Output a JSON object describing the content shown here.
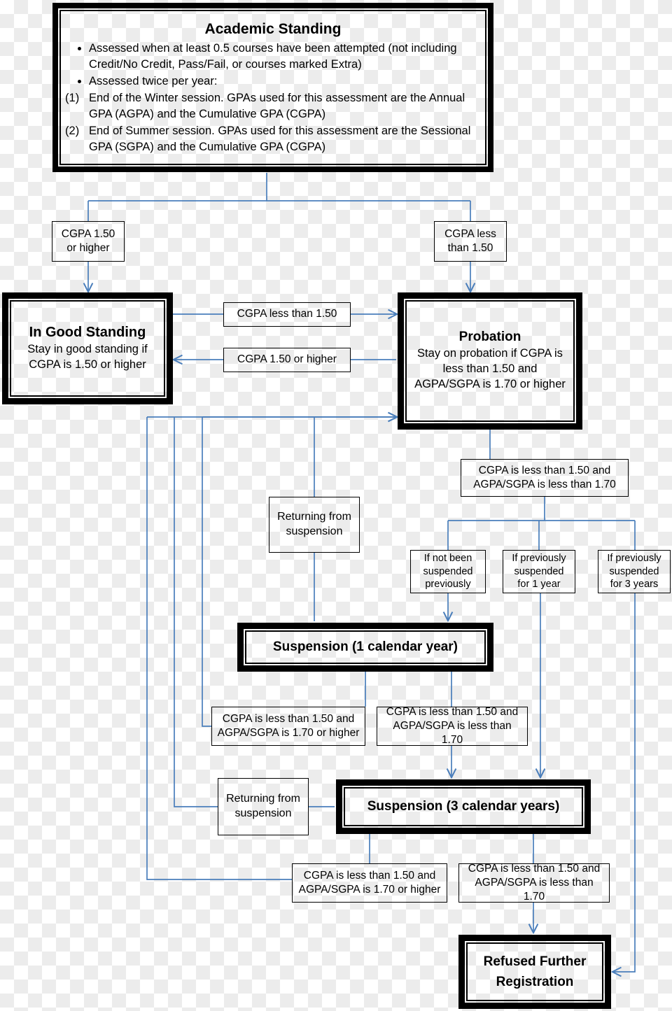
{
  "diagram": {
    "title": "Academic Standing",
    "accent_line_color": "#4a7ebb",
    "node_border_color": "#000000"
  },
  "header": {
    "title": "Academic Standing",
    "bullets": [
      "Assessed when at least 0.5 courses have been attempted (not including Credit/No Credit, Pass/Fail, or courses marked Extra)",
      "Assessed twice per year:"
    ],
    "numbered": [
      "End of the Winter session. GPAs used for this assessment are the Annual GPA (AGPA) and the Cumulative GPA (CGPA)",
      "End of Summer session. GPAs used for this assessment are the Sessional GPA (SGPA) and the Cumulative GPA (CGPA)"
    ]
  },
  "nodes": {
    "cgpa_high": "CGPA 1.50 or higher",
    "cgpa_low": "CGPA less than 1.50",
    "good_standing_title": "In Good Standing",
    "good_standing_sub": "Stay in good standing if CGPA is 1.50 or higher",
    "probation_title": "Probation",
    "probation_sub": "Stay on probation if CGPA is less than 1.50 and AGPA/SGPA is 1.70 or higher",
    "good_to_prob": "CGPA less than 1.50",
    "prob_to_good": "CGPA 1.50 or higher",
    "prob_fail": "CGPA is less than 1.50 and AGPA/SGPA is less than 1.70",
    "if_not_suspended": "If not been suspended previously",
    "if_suspended_1yr": "If previously suspended for 1 year",
    "if_suspended_3yr": "If previously suspended for 3 years",
    "returning_1": "Returning from suspension",
    "returning_2": "Returning from suspension",
    "suspension_1": "Suspension (1 calendar year)",
    "suspension_3": "Suspension (3 calendar years)",
    "susp1_ok": "CGPA is less than 1.50 and AGPA/SGPA is 1.70 or higher",
    "susp1_bad": "CGPA is less than 1.50 and AGPA/SGPA is less than 1.70",
    "susp3_ok": "CGPA is less than 1.50 and AGPA/SGPA is 1.70 or higher",
    "susp3_bad": "CGPA is less than 1.50 and AGPA/SGPA is less than 1.70",
    "refused": "Refused Further Registration"
  }
}
